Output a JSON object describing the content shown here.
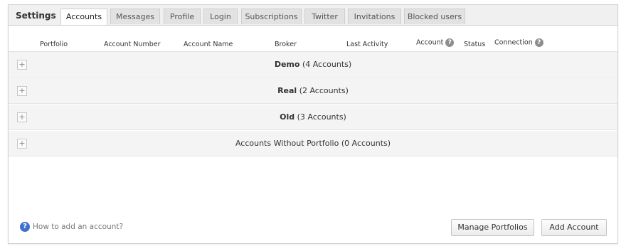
{
  "settings_title": "Settings",
  "tabs": [
    {
      "label": "Accounts",
      "active": true
    },
    {
      "label": "Messages",
      "active": false
    },
    {
      "label": "Profile",
      "active": false
    },
    {
      "label": "Login",
      "active": false
    },
    {
      "label": "Subscriptions",
      "active": false
    },
    {
      "label": "Twitter",
      "active": false
    },
    {
      "label": "Invitations",
      "active": false
    },
    {
      "label": "Blocked users",
      "active": false
    }
  ],
  "columns": {
    "portfolio": "Portfolio",
    "account_number": "Account Number",
    "account_name": "Account Name",
    "broker": "Broker",
    "last_activity": "Last Activity",
    "account": "Account",
    "status": "Status",
    "connection": "Connection",
    "help_glyph": "?"
  },
  "groups": [
    {
      "name": "Demo",
      "count_text": "(4 Accounts)",
      "bold": true,
      "expander": "+"
    },
    {
      "name": "Real",
      "count_text": "(2 Accounts)",
      "bold": true,
      "expander": "+"
    },
    {
      "name": "Old",
      "count_text": "(3 Accounts)",
      "bold": true,
      "expander": "+"
    },
    {
      "name": "Accounts Without Portfolio",
      "count_text": "(0 Accounts)",
      "bold": false,
      "expander": "+"
    }
  ],
  "footer": {
    "help_icon_glyph": "?",
    "help_link": "How to add an account?",
    "manage_portfolios": "Manage Portfolios",
    "add_account": "Add Account"
  },
  "colors": {
    "active_tab_bg": "#ffffff",
    "inactive_tab_bg": "#e2e2e2",
    "group_row_bg": "#f4f4f4",
    "help_icon_blue": "#3f6fd0"
  }
}
